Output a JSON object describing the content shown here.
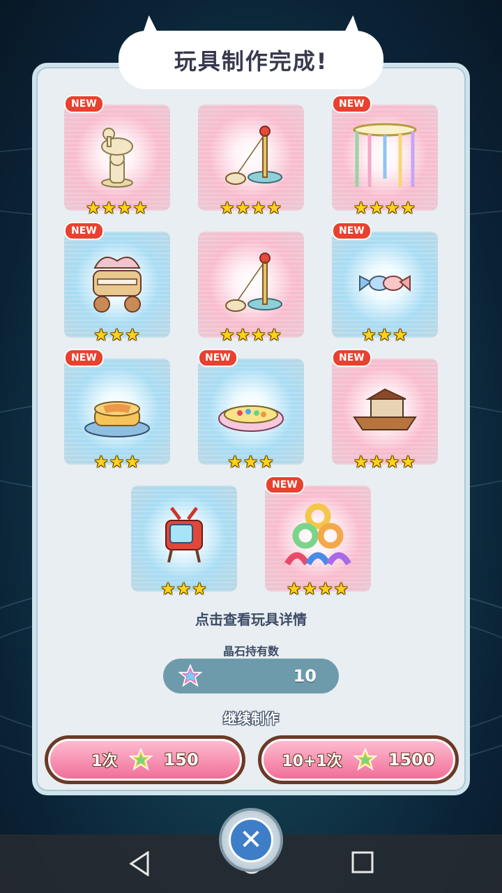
{
  "title": "玩具制作完成!",
  "new_label": "NEW",
  "items": [
    {
      "icon": "duck-statue-icon",
      "stars": "★★★★",
      "theme": "pink",
      "is_new": true
    },
    {
      "icon": "cat-teaser-pole-icon",
      "stars": "★★★★",
      "theme": "pink",
      "is_new": false
    },
    {
      "icon": "carousel-frame-icon",
      "stars": "★★★★",
      "theme": "pink",
      "is_new": true
    },
    {
      "icon": "bird-carriage-icon",
      "stars": "★★★",
      "theme": "blue",
      "is_new": true
    },
    {
      "icon": "cat-teaser-pole-icon",
      "stars": "★★★★",
      "theme": "pink",
      "is_new": false
    },
    {
      "icon": "candy-icon",
      "stars": "★★★",
      "theme": "blue",
      "is_new": true
    },
    {
      "icon": "pancake-icon",
      "stars": "★★★",
      "theme": "blue",
      "is_new": true
    },
    {
      "icon": "ball-pool-icon",
      "stars": "★★★",
      "theme": "blue",
      "is_new": true
    },
    {
      "icon": "boat-icon",
      "stars": "★★★★",
      "theme": "pink",
      "is_new": true
    },
    {
      "icon": "tv-icon",
      "stars": "★★★",
      "theme": "blue",
      "is_new": false
    },
    {
      "icon": "tire-pyramid-icon",
      "stars": "★★★★",
      "theme": "pink",
      "is_new": true
    }
  ],
  "hint": "点击查看玩具详情",
  "crystal_owned_label": "晶石持有数",
  "crystal_owned_value": "10",
  "continue_label": "继续制作",
  "buttons": [
    {
      "label": "1次",
      "cost": "150"
    },
    {
      "label": "10+1次",
      "cost": "1500"
    }
  ],
  "colors": {
    "panel": "#e8eef1",
    "button": "#f06a96",
    "close": "#3e7ec9"
  }
}
